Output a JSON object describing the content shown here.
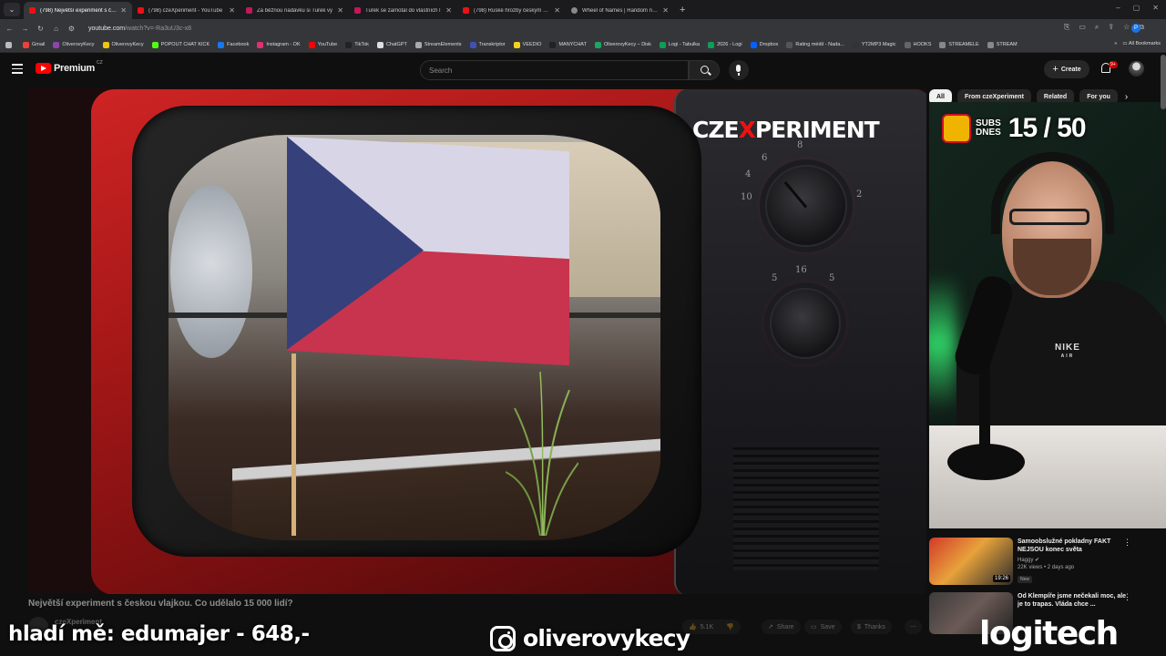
{
  "browser": {
    "tabs": [
      {
        "label": "(798) Největší experiment s čes",
        "active": true,
        "icon": "youtube-icon"
      },
      {
        "label": "(798) czeXperiment - YouTube",
        "active": false,
        "icon": "youtube-icon"
      },
      {
        "label": "Za běžnou nadávku si Turek vy",
        "active": false,
        "icon": "seznam-icon"
      },
      {
        "label": "Turek se zamotal do vlastních l",
        "active": false,
        "icon": "seznam-icon"
      },
      {
        "label": "(798) Ruské hrozby českým zbr",
        "active": false,
        "icon": "youtube-icon"
      },
      {
        "label": "Wheel of Names | Random nam",
        "active": false,
        "icon": "wheel-icon"
      }
    ],
    "url_host": "youtube.com",
    "url_path": "/watch?v=-Ra3uU3c-x8",
    "bookmarks": [
      {
        "label": "Gmail",
        "color": "#ea4335"
      },
      {
        "label": "OliverovyKecy",
        "color": "#8e44ad"
      },
      {
        "label": "OliverovyKecy",
        "color": "#f1c40f"
      },
      {
        "label": "POPOUT CHAT KICK",
        "color": "#53fc18"
      },
      {
        "label": "Facebook",
        "color": "#1877f2"
      },
      {
        "label": "Instagram - OK",
        "color": "#e1306c"
      },
      {
        "label": "YouTube",
        "color": "#ff0000"
      },
      {
        "label": "TikTok",
        "color": "#222222"
      },
      {
        "label": "ChatGPT",
        "color": "#dddddd"
      },
      {
        "label": "StreamElements",
        "color": "#aaaaaa"
      },
      {
        "label": "Transkriptor",
        "color": "#3f51b5"
      },
      {
        "label": "VEEDIO",
        "color": "#f7d21a"
      },
      {
        "label": "MANYCHAT",
        "color": "#222222"
      },
      {
        "label": "OliverovyKecy – Disk",
        "color": "#1fa463"
      },
      {
        "label": "Logi - Tabulka",
        "color": "#0f9d58"
      },
      {
        "label": "2026 - Logi",
        "color": "#0f9d58"
      },
      {
        "label": "Dropbox",
        "color": "#0061ff"
      },
      {
        "label": "Rating médií - Nada...",
        "color": "#555555"
      },
      {
        "label": "YT2MP3 Magic",
        "color": "#333333"
      },
      {
        "label": "HOOKS",
        "color": "#666666"
      },
      {
        "label": "STREAMELE",
        "color": "#888888"
      },
      {
        "label": "STREAM",
        "color": "#888888"
      }
    ],
    "all_bookmarks": "All Bookmarks",
    "profile_initial": "P"
  },
  "youtube": {
    "logo_text": "Premium",
    "logo_country": "CZ",
    "search_placeholder": "Search",
    "create_label": "Create",
    "notif_badge": "9+"
  },
  "player": {
    "brand_pre": "CZE",
    "brand_x": "X",
    "brand_post": "PERIMENT",
    "dial_numbers": [
      "8",
      "6",
      "4",
      "2",
      "10",
      "5",
      "16",
      "5"
    ]
  },
  "overlay": {
    "subs_label_line1": "SUBS",
    "subs_label_line2": "DNES",
    "subs_value": "15 / 50",
    "shirt_brand": "NIKE",
    "shirt_sub": "AIR",
    "left_text": "hladí mě: edumajer - 648,-",
    "instagram_handle": "oliverovykecy",
    "sponsor": "logitech"
  },
  "chips": [
    {
      "label": "All",
      "active": true
    },
    {
      "label": "From czeXperiment",
      "active": false
    },
    {
      "label": "Related",
      "active": false
    },
    {
      "label": "For you",
      "active": false
    }
  ],
  "recommendations": [
    {
      "title": "Samoobslužné pokladny FAKT NEJSOU konec světa",
      "channel": "Haggy",
      "meta": "22K views • 2 days ago",
      "badge": "New",
      "duration": "19:26"
    },
    {
      "title": "Od Klempíře jsme nečekali moc, ale je to trapas. Vláda chce ...",
      "channel": "",
      "meta": "",
      "badge": "",
      "duration": ""
    }
  ],
  "video": {
    "title": "Největší experiment s českou vlajkou. Co udělalo 15 000 lidí?",
    "channel": "czeXperiment",
    "like_count": "5.1K",
    "share_label": "Share",
    "save_label": "Save",
    "thanks_label": "Thanks"
  }
}
